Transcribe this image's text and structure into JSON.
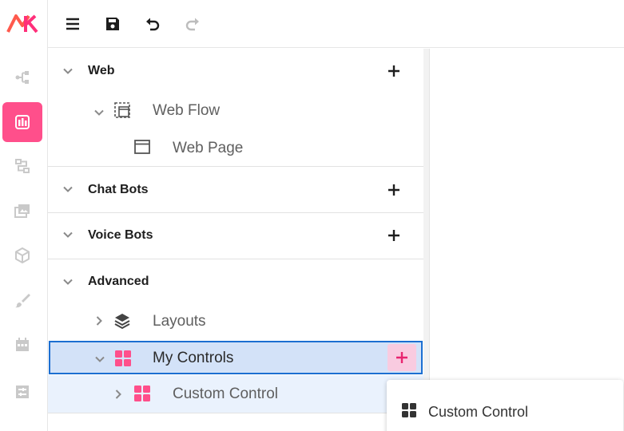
{
  "app": {
    "logo_text": "MK",
    "accent": "#ff4f8b",
    "selection_color": "#1c6fd1"
  },
  "toolbar": {
    "items": [
      {
        "icon": "menu-icon"
      },
      {
        "icon": "save-icon"
      },
      {
        "icon": "undo-icon"
      },
      {
        "icon": "redo-icon"
      }
    ]
  },
  "rail": {
    "items": [
      {
        "icon": "flow-icon"
      },
      {
        "icon": "ui-designer-icon",
        "active": true
      },
      {
        "icon": "workflow-icon"
      },
      {
        "icon": "media-icon"
      },
      {
        "icon": "package-icon"
      },
      {
        "icon": "brush-icon"
      },
      {
        "icon": "calendar-icon"
      },
      {
        "icon": "data-icon"
      }
    ]
  },
  "tree": {
    "sections": [
      {
        "title": "Web",
        "children": [
          {
            "label": "Web Flow",
            "children": [
              {
                "label": "Web Page"
              }
            ]
          }
        ]
      },
      {
        "title": "Chat Bots"
      },
      {
        "title": "Voice Bots"
      },
      {
        "title": "Advanced",
        "children": [
          {
            "label": "Layouts"
          },
          {
            "label": "My Controls",
            "selected": true,
            "children": [
              {
                "label": "Custom Control"
              }
            ]
          }
        ]
      }
    ]
  },
  "popup": {
    "items": [
      {
        "label": "Custom Control",
        "icon": "grid-icon"
      }
    ]
  }
}
